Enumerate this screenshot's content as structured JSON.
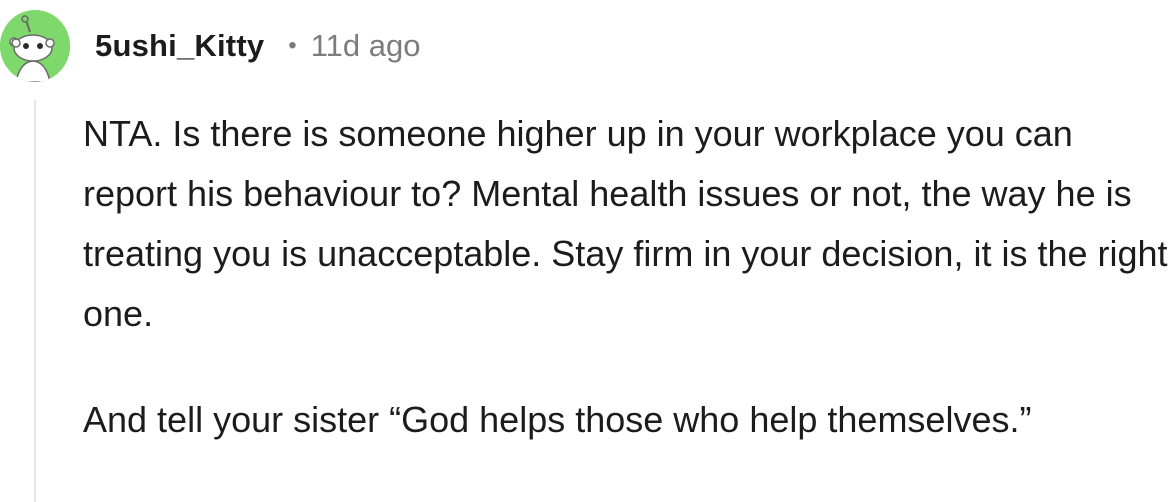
{
  "comment": {
    "username": "5ushi_Kitty",
    "separator": "•",
    "timestamp": "11d ago",
    "avatar_icon": "reddit-snoo-avatar-icon",
    "avatar_color": "#7fd86b",
    "paragraphs": [
      "NTA. Is there is someone higher up in your workplace you can report his behaviour to? Mental health issues or not, the way he is treating you is unacceptable. Stay firm in your decision, it is the right one.",
      "And tell your sister “God helps those who help themselves.”"
    ]
  }
}
